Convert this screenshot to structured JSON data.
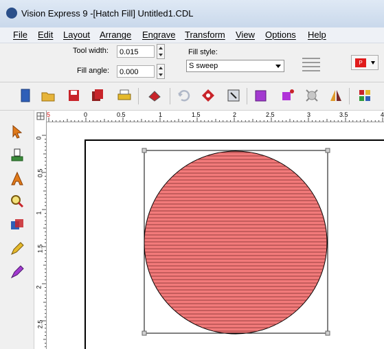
{
  "window": {
    "title": "Vision Express 9 -[Hatch Fill] Untitled1.CDL"
  },
  "menu": [
    "File",
    "Edit",
    "Layout",
    "Arrange",
    "Engrave",
    "Transform",
    "View",
    "Options",
    "Help"
  ],
  "properties": {
    "tool_width_label": "Tool width:",
    "tool_width_value": "0.015",
    "fill_angle_label": "Fill angle:",
    "fill_angle_value": "0.000",
    "fill_style_label": "Fill style:",
    "fill_style_value": "S sweep",
    "color_letter": "P"
  },
  "colors": {
    "circle_fill": "#f27a7a",
    "hatch_line": "#7a2a2a",
    "swatch": "#e01b1b"
  },
  "toolbar_icons": [
    "new-file-icon",
    "open-folder-icon",
    "save-icon",
    "save-copy-icon",
    "print-icon",
    "engrave-icon",
    "undo-icon",
    "redo-icon",
    "import-icon",
    "export-icon",
    "node-edit-icon",
    "weld-icon",
    "mirror-icon",
    "palette-icon"
  ],
  "toolbox_icons": [
    "pointer-tool-icon",
    "node-tool-icon",
    "text-tool-icon",
    "zoom-tool-icon",
    "fill-tool-icon",
    "pencil-tool-icon",
    "pen-tool-icon"
  ],
  "ruler_top": {
    "red_label": "5",
    "labels": [
      "0",
      "0.5",
      "1",
      "1.5",
      "2",
      "2.5",
      "3",
      "3.5",
      "4"
    ]
  },
  "ruler_left": {
    "labels": [
      "0",
      "0.5",
      "1",
      "1.5",
      "2",
      "2.5"
    ]
  }
}
